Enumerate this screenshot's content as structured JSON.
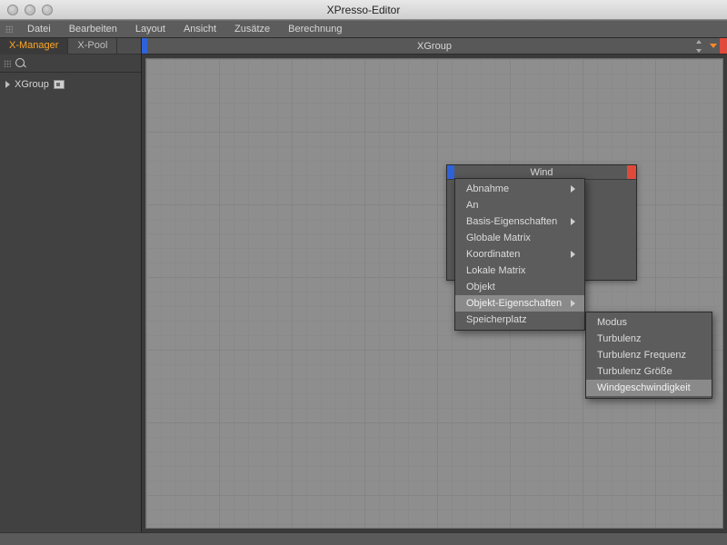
{
  "window": {
    "title": "XPresso-Editor"
  },
  "menu": {
    "items": [
      "Datei",
      "Bearbeiten",
      "Layout",
      "Ansicht",
      "Zusätze",
      "Berechnung"
    ]
  },
  "sidebar": {
    "tabs": [
      {
        "label": "X-Manager",
        "active": true
      },
      {
        "label": "X-Pool",
        "active": false
      }
    ],
    "tree": [
      {
        "label": "XGroup"
      }
    ]
  },
  "canvas": {
    "title": "XGroup",
    "node": {
      "title": "Wind"
    }
  },
  "context_menu": {
    "items": [
      {
        "label": "Abnahme",
        "submenu": true
      },
      {
        "label": "An"
      },
      {
        "label": "Basis-Eigenschaften",
        "submenu": true
      },
      {
        "label": "Globale Matrix"
      },
      {
        "label": "Koordinaten",
        "submenu": true
      },
      {
        "label": "Lokale Matrix"
      },
      {
        "label": "Objekt"
      },
      {
        "label": "Objekt-Eigenschaften",
        "submenu": true,
        "highlighted": true
      },
      {
        "label": "Speicherplatz"
      }
    ],
    "submenu": {
      "parent": "Objekt-Eigenschaften",
      "items": [
        {
          "label": "Modus"
        },
        {
          "label": "Turbulenz"
        },
        {
          "label": "Turbulenz Frequenz"
        },
        {
          "label": "Turbulenz Größe"
        },
        {
          "label": "Windgeschwindigkeit",
          "highlighted": true
        }
      ]
    }
  },
  "colors": {
    "accent_orange": "#ffa624",
    "port_blue": "#2f62d9",
    "port_red": "#e04a3a"
  }
}
